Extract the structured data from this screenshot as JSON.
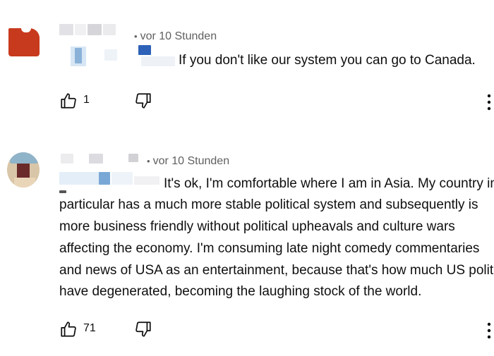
{
  "comments": [
    {
      "timestamp": "vor 10 Stunden",
      "text": "If you don't like our system you can go to Canada.",
      "like_count": "1",
      "icons": {
        "like": "thumbs-up-icon",
        "dislike": "thumbs-down-icon",
        "more": "more-vert-icon"
      }
    },
    {
      "timestamp": "vor 10 Stunden",
      "text_lines": [
        "It's ok, I'm comfortable where I am in Asia. My country in",
        "particular has a much more stable political system and subsequently is",
        "more business friendly without political upheavals and culture wars",
        "affecting the economy. I'm consuming late night comedy commentaries",
        "and news of USA as an entertainment, because that's how much US politics",
        "have degenerated, becoming the laughing stock of the world."
      ],
      "like_count": "71",
      "icons": {
        "like": "thumbs-up-icon",
        "dislike": "thumbs-down-icon",
        "more": "more-vert-icon"
      }
    }
  ]
}
